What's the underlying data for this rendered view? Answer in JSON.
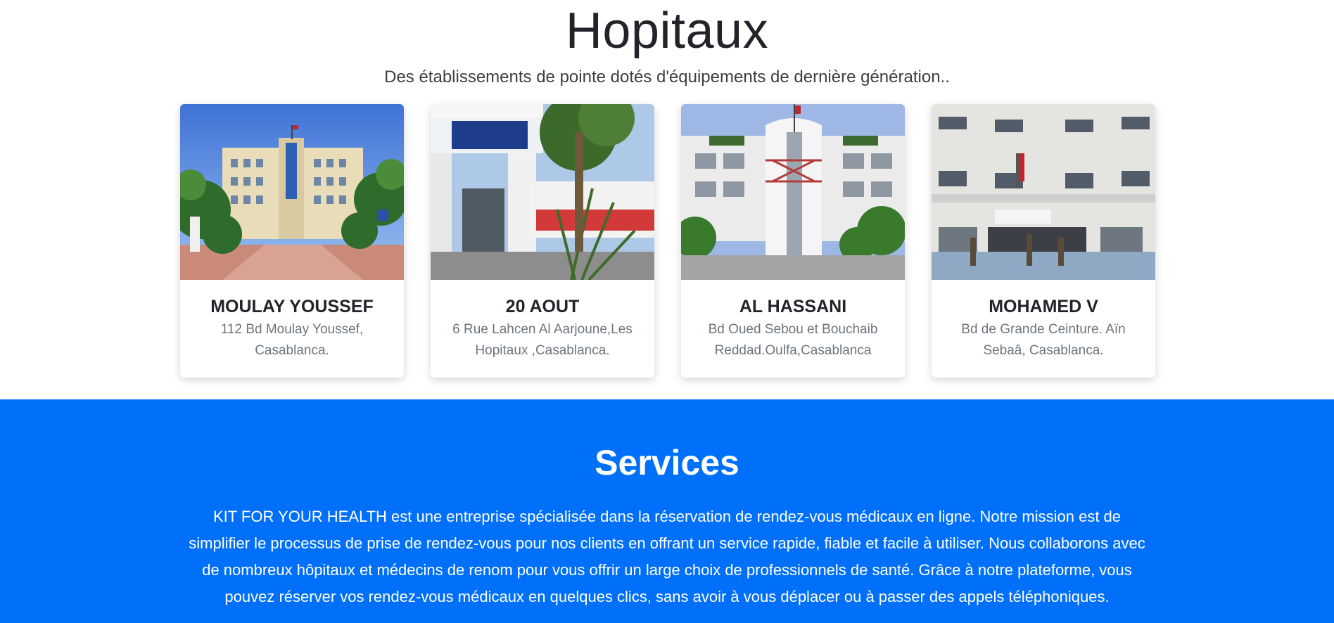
{
  "hospitals_section": {
    "title": "Hopitaux",
    "subtitle": "Des établissements de pointe dotés d'équipements de dernière génération..",
    "cards": [
      {
        "name": "MOULAY YOUSSEF",
        "address": "112 Bd Moulay Youssef, Casablanca."
      },
      {
        "name": "20 AOUT",
        "address": "6 Rue Lahcen Al Aarjoune,Les Hopitaux ,Casablanca."
      },
      {
        "name": "AL HASSANI",
        "address": "Bd Oued Sebou et Bouchaib Reddad.Oulfa,Casablanca"
      },
      {
        "name": "MOHAMED V",
        "address": "Bd de Grande Ceinture. Aïn Sebaâ, Casablanca."
      }
    ]
  },
  "services_section": {
    "title": "Services",
    "text": "KIT FOR YOUR HEALTH est une entreprise spécialisée dans la réservation de rendez-vous médicaux en ligne. Notre mission est de simplifier le processus de prise de rendez-vous pour nos clients en offrant un service rapide, fiable et facile à utiliser. Nous collaborons avec de nombreux hôpitaux et médecins de renom pour vous offrir un large choix de professionnels de santé. Grâce à notre plateforme, vous pouvez réserver vos rendez-vous médicaux en quelques clics, sans avoir à vous déplacer ou à passer des appels téléphoniques."
  },
  "colors": {
    "services_bg": "#0070fa",
    "card_address": "#6c757d"
  }
}
